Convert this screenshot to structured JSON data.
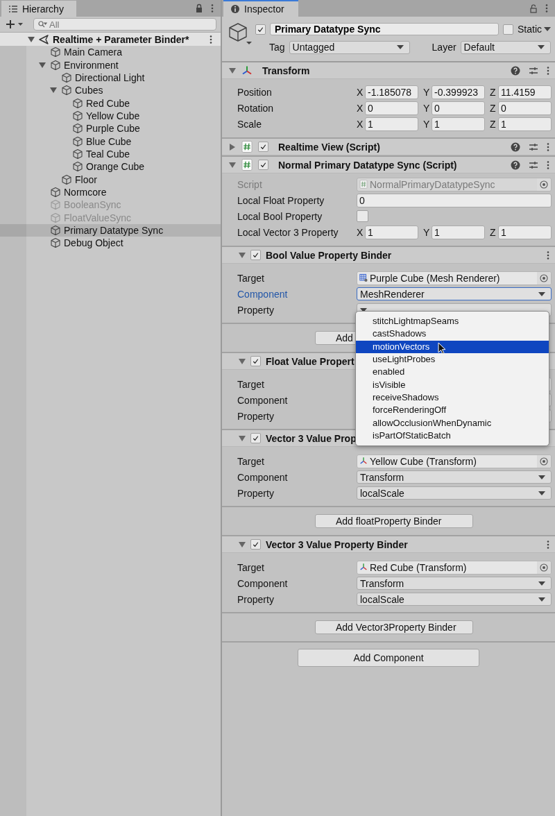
{
  "hierarchy": {
    "tab": "Hierarchy",
    "search": {
      "placeholder": "All"
    },
    "scene": {
      "name": "Realtime + Parameter Binder*",
      "expanded": true
    },
    "items": [
      {
        "name": "Main Camera",
        "disabled": false,
        "selected": false
      },
      {
        "name": "Environment",
        "expanded": true,
        "disabled": false,
        "selected": false,
        "children": [
          {
            "name": "Directional Light",
            "disabled": false,
            "selected": false
          },
          {
            "name": "Cubes",
            "expanded": true,
            "disabled": false,
            "selected": false,
            "children": [
              {
                "name": "Red Cube",
                "disabled": false,
                "selected": false
              },
              {
                "name": "Yellow Cube",
                "disabled": false,
                "selected": false
              },
              {
                "name": "Purple Cube",
                "disabled": false,
                "selected": false
              },
              {
                "name": "Blue Cube",
                "disabled": false,
                "selected": false
              },
              {
                "name": "Teal Cube",
                "disabled": false,
                "selected": false
              },
              {
                "name": "Orange Cube",
                "disabled": false,
                "selected": false
              }
            ]
          },
          {
            "name": "Floor",
            "disabled": false,
            "selected": false
          }
        ]
      },
      {
        "name": "Normcore",
        "disabled": false,
        "selected": false
      },
      {
        "name": "BooleanSync",
        "disabled": true,
        "selected": false
      },
      {
        "name": "FloatValueSync",
        "disabled": true,
        "selected": false
      },
      {
        "name": "Primary Datatype Sync",
        "disabled": false,
        "selected": true
      },
      {
        "name": "Debug Object",
        "disabled": false,
        "selected": false
      }
    ]
  },
  "inspector": {
    "tab": "Inspector",
    "object": {
      "active": true,
      "name": "Primary Datatype Sync",
      "static": false,
      "static_label": "Static",
      "tag_label": "Tag",
      "tag": "Untagged",
      "layer_label": "Layer",
      "layer": "Default"
    },
    "sections": [
      {
        "kind": "transform",
        "title": "Transform",
        "expanded": true,
        "rows": [
          {
            "label": "Position",
            "values": [
              {
                "axis": "X",
                "value": "-1.185078"
              },
              {
                "axis": "Y",
                "value": "-0.399923"
              },
              {
                "axis": "Z",
                "value": "11.4159"
              }
            ]
          },
          {
            "label": "Rotation",
            "values": [
              {
                "axis": "X",
                "value": "0"
              },
              {
                "axis": "Y",
                "value": "0"
              },
              {
                "axis": "Z",
                "value": "0"
              }
            ]
          },
          {
            "label": "Scale",
            "values": [
              {
                "axis": "X",
                "value": "1"
              },
              {
                "axis": "Y",
                "value": "1"
              },
              {
                "axis": "Z",
                "value": "1"
              }
            ]
          }
        ]
      },
      {
        "kind": "component",
        "title": "Realtime View (Script)",
        "enabled": true,
        "expanded": false
      },
      {
        "kind": "component",
        "title": "Normal Primary Datatype Sync (Script)",
        "enabled": true,
        "expanded": true,
        "rows": [
          {
            "kind": "object",
            "label": "Script",
            "value": "NormalPrimaryDatatypeSync",
            "disabled": true,
            "focused": false
          },
          {
            "kind": "text",
            "label": "Local Float Property",
            "value": "0",
            "disabled": false,
            "focused": false
          },
          {
            "kind": "checkbox",
            "label": "Local Bool Property",
            "checked": false,
            "disabled": false,
            "focused": false
          },
          {
            "kind": "vector",
            "label": "Local Vector 3 Property",
            "values": [
              {
                "axis": "X",
                "value": "1"
              },
              {
                "axis": "Y",
                "value": "1"
              },
              {
                "axis": "Z",
                "value": "1"
              }
            ],
            "disabled": false,
            "focused": false
          }
        ]
      },
      {
        "kind": "binder",
        "title": "Bool Value Property Binder",
        "enabled": true,
        "expanded": true,
        "rows": [
          {
            "kind": "object",
            "label": "Target",
            "value": "Purple Cube (Mesh Renderer)",
            "disabled": false,
            "focused": false
          },
          {
            "kind": "dropdown",
            "label": "Component",
            "value": "MeshRenderer",
            "disabled": false,
            "focused": true
          },
          {
            "kind": "dropdown",
            "label": "Property",
            "disabled": false,
            "focused": false
          }
        ]
      },
      {
        "kind": "add-button",
        "label": "Add"
      },
      {
        "kind": "binder",
        "title": "Float Value Propert",
        "enabled": true,
        "expanded": true,
        "rows": [
          {
            "kind": "object",
            "label": "Target",
            "disabled": false,
            "focused": false
          },
          {
            "kind": "dropdown",
            "label": "Component",
            "disabled": false,
            "focused": false
          },
          {
            "kind": "dropdown",
            "label": "Property",
            "disabled": false,
            "focused": false
          }
        ]
      },
      {
        "kind": "binder",
        "title": "Vector 3 Value Prop",
        "enabled": true,
        "expanded": true,
        "rows": [
          {
            "kind": "object",
            "label": "Target",
            "value": "Yellow Cube (Transform)",
            "disabled": false,
            "focused": false
          },
          {
            "kind": "dropdown",
            "label": "Component",
            "value": "Transform",
            "disabled": false,
            "focused": false
          },
          {
            "kind": "dropdown",
            "label": "Property",
            "value": "localScale",
            "disabled": false,
            "focused": false
          }
        ]
      },
      {
        "kind": "add-button",
        "label": "Add floatProperty Binder"
      },
      {
        "kind": "binder",
        "title": "Vector 3 Value Property Binder",
        "enabled": true,
        "expanded": true,
        "rows": [
          {
            "kind": "object",
            "label": "Target",
            "value": "Red Cube (Transform)",
            "disabled": false,
            "focused": false
          },
          {
            "kind": "dropdown",
            "label": "Component",
            "value": "Transform",
            "disabled": false,
            "focused": false
          },
          {
            "kind": "dropdown",
            "label": "Property",
            "value": "localScale",
            "disabled": false,
            "focused": false
          }
        ]
      },
      {
        "kind": "add-button",
        "label": "Add Vector3Property Binder"
      },
      {
        "kind": "add-component",
        "label": "Add Component"
      }
    ],
    "dropdown_menu": {
      "options": [
        {
          "label": "stitchLightmapSeams",
          "selected": false
        },
        {
          "label": "castShadows",
          "selected": false
        },
        {
          "label": "motionVectors",
          "selected": true
        },
        {
          "label": "useLightProbes",
          "selected": false
        },
        {
          "label": "enabled",
          "selected": false
        },
        {
          "label": "isVisible",
          "selected": false
        },
        {
          "label": "receiveShadows",
          "selected": false
        },
        {
          "label": "forceRenderingOff",
          "selected": false
        },
        {
          "label": "allowOcclusionWhenDynamic",
          "selected": false
        },
        {
          "label": "isPartOfStaticBatch",
          "selected": false
        }
      ]
    }
  }
}
